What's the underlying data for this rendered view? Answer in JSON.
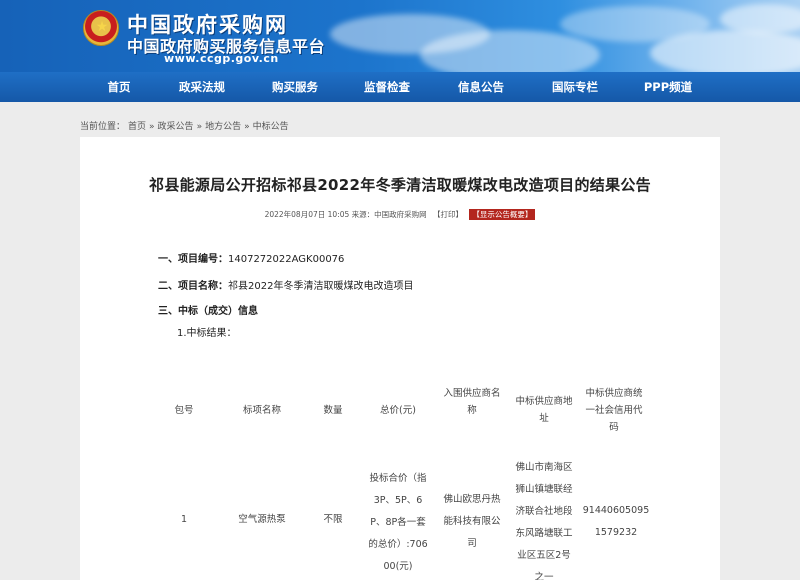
{
  "header": {
    "site_title": "中国政府采购网",
    "site_subtitle": "中国政府购买服务信息平台",
    "url": "www.ccgp.gov.cn"
  },
  "nav": {
    "items": [
      "首页",
      "政采法规",
      "购买服务",
      "监督检查",
      "信息公告",
      "国际专栏",
      "PPP频道"
    ]
  },
  "breadcrumb": {
    "prefix": "当前位置：",
    "items": [
      "首页",
      "政采公告",
      "地方公告",
      "中标公告"
    ],
    "separator": "»"
  },
  "article": {
    "title": "祁县能源局公开招标祁县2022年冬季清洁取暖煤改电改造项目的结果公告",
    "date": "2022年08月07日 10:05",
    "source": "来源：中国政府采购网",
    "print_label": "【打印】",
    "summary_label": "【显示公告概要】",
    "sections": [
      {
        "label": "一、项目编号：",
        "value": "1407272022AGK00076"
      },
      {
        "label": "二、项目名称：",
        "value": "祁县2022年冬季清洁取暖煤改电改造项目"
      },
      {
        "label": "三、中标（成交）信息",
        "value": ""
      }
    ],
    "sub_heading": "1.中标结果："
  },
  "table": {
    "headers": {
      "package": "包号",
      "item_name": "标项名称",
      "quantity": "数量",
      "total_price": "总价(元)",
      "supplier": [
        "入围供应商名",
        "称"
      ],
      "address": [
        "中标供应商地",
        "址"
      ],
      "credit_code": [
        "中标供应商统",
        "一社会信用代",
        "码"
      ]
    },
    "rows": [
      {
        "package": "1",
        "item_name": "空气源热泵",
        "quantity": "不限",
        "total_price": [
          "投标合价（指",
          "3P、5P、6",
          "P、8P各一套",
          "的总价）:706",
          "00(元)"
        ],
        "supplier": [
          "佛山欧思丹热",
          "能科技有限公",
          "司"
        ],
        "address": [
          "佛山市南海区",
          "狮山镇塘联经",
          "济联合社地段",
          "东风路塘联工",
          "业区五区2号",
          "之一"
        ],
        "credit_code": [
          "91440605095",
          "1579232"
        ]
      }
    ]
  },
  "colors": {
    "banner": "#1c74cc",
    "nav": "#1558a8",
    "summary_button": "#b3261e",
    "page_background": "#ececec"
  }
}
